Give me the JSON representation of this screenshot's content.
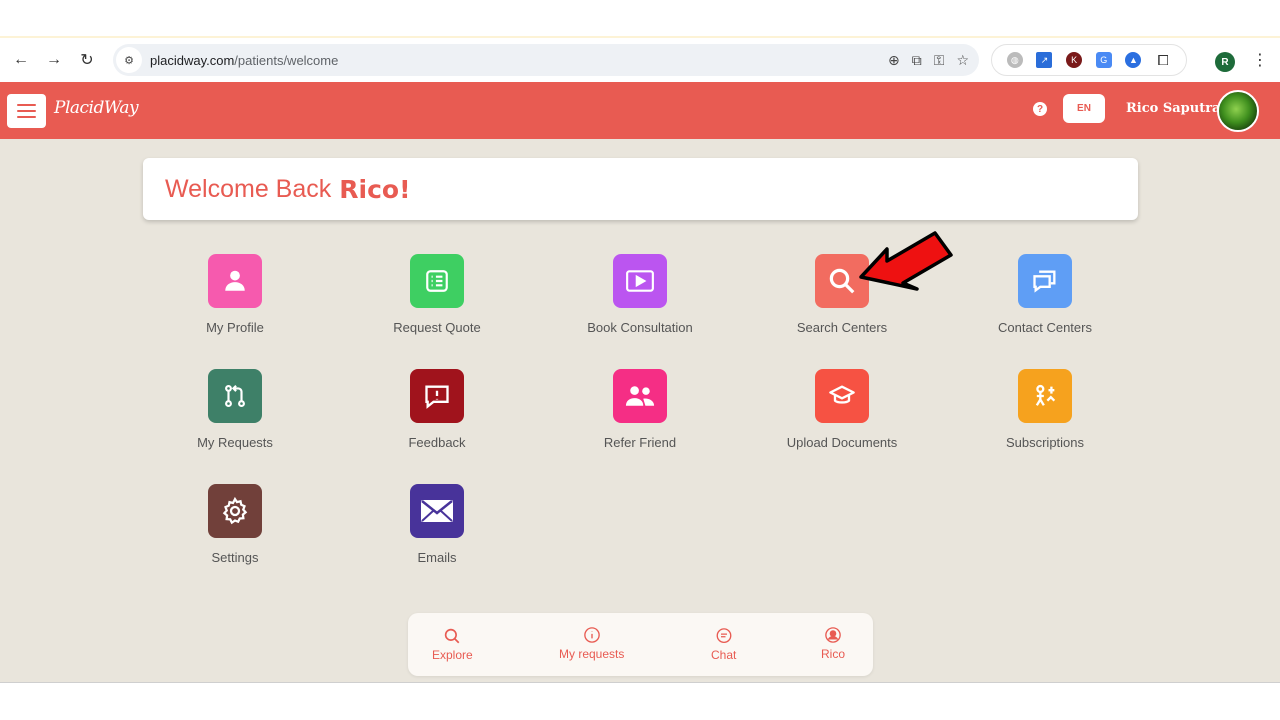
{
  "browser": {
    "url_domain": "placidway.com",
    "url_path": "/patients/welcome",
    "profile_initial": "R",
    "extensions": [
      "globe-icon",
      "chart-icon",
      "k-icon",
      "translate-icon",
      "vpn-icon",
      "puzzle-icon"
    ]
  },
  "header": {
    "logo_text": "PlacidWay",
    "lang": "EN",
    "help": "?",
    "user_name": "Rico Saputra",
    "brand_color": "#e85b52"
  },
  "welcome": {
    "prefix": "Welcome Back",
    "name": "Rico!"
  },
  "tiles": [
    {
      "label": "My Profile",
      "icon": "user-icon",
      "color": "#f65aae"
    },
    {
      "label": "Request Quote",
      "icon": "list-icon",
      "color": "#3ecf62"
    },
    {
      "label": "Book Consultation",
      "icon": "play-icon",
      "color": "#bb55f0"
    },
    {
      "label": "Search Centers",
      "icon": "search-icon",
      "color": "#f26c60"
    },
    {
      "label": "Contact Centers",
      "icon": "chat-icon",
      "color": "#5f9ef5"
    },
    {
      "label": "My Requests",
      "icon": "git-pull-icon",
      "color": "#3e8068"
    },
    {
      "label": "Feedback",
      "icon": "alert-message-icon",
      "color": "#a0131c"
    },
    {
      "label": "Refer Friend",
      "icon": "users-icon",
      "color": "#f52e85"
    },
    {
      "label": "Upload Documents",
      "icon": "graduation-cap-icon",
      "color": "#f65243"
    },
    {
      "label": "Subscriptions",
      "icon": "subscription-icon",
      "color": "#f6a21e"
    },
    {
      "label": "Settings",
      "icon": "gear-icon",
      "color": "#71403a"
    },
    {
      "label": "Emails",
      "icon": "envelope-icon",
      "color": "#48339a"
    }
  ],
  "bottom_nav": [
    {
      "label": "Explore",
      "icon": "search-icon"
    },
    {
      "label": "My requests",
      "icon": "info-icon"
    },
    {
      "label": "Chat",
      "icon": "chat-bubble-icon"
    },
    {
      "label": "Rico",
      "icon": "user-circle-icon"
    }
  ]
}
